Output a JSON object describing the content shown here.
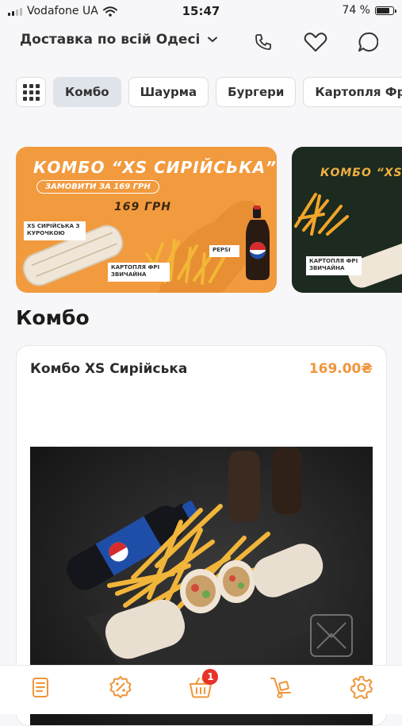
{
  "status_bar": {
    "carrier": "Vodafone UA",
    "time": "15:47",
    "battery": "74 %"
  },
  "header": {
    "delivery_label": "Доставка по всій Одесі",
    "icons": [
      "phone-icon",
      "heart-icon",
      "chat-icon"
    ]
  },
  "categories": {
    "items": [
      "Комбо",
      "Шаурма",
      "Бургери",
      "Картопля Фрі"
    ],
    "active": "Комбо"
  },
  "banners": [
    {
      "title": "КОМБО “XS СИРІЙСЬКА”",
      "order_text": "ЗАМОВИТИ ЗА 169 ГРН",
      "price_text": "169 ГРН",
      "item_shawarma": "XS СИРІЙСЬКА З КУРОЧКОЮ",
      "item_fries": "КАРТОПЛЯ ФРІ ЗВИЧАЙНА",
      "item_pepsi": "PEPSI"
    },
    {
      "title": "КОМБО “XS",
      "item_fries": "КАРТОПЛЯ ФРІ ЗВИЧАЙНА"
    }
  ],
  "section": {
    "title": "Комбо"
  },
  "products": [
    {
      "name": "Комбо XS Сирійська",
      "price": "169.00₴"
    }
  ],
  "bottom_nav": {
    "items": [
      "menu-icon",
      "discount-icon",
      "cart-icon",
      "delivery-icon",
      "settings-icon"
    ],
    "cart_count": "1"
  },
  "colors": {
    "accent": "#f0953a",
    "badge": "#e8322a",
    "chip_active": "#dfe3ea"
  }
}
